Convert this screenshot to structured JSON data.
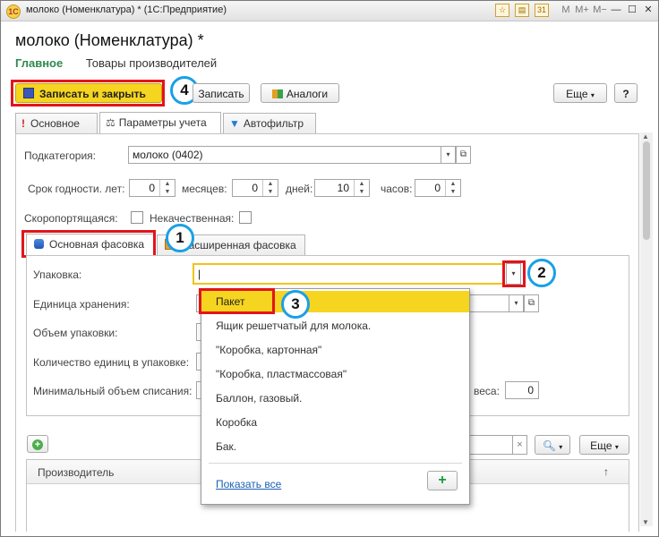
{
  "window": {
    "title": "молоко (Номенклатура) * (1С:Предприятие)",
    "app_icon": "1C",
    "tb_icons": [
      "M",
      "M+",
      "M−",
      "—",
      "☐",
      "✕"
    ]
  },
  "header": {
    "title": "молоко (Номенклатура) *",
    "nav_active": "Главное",
    "nav_other": "Товары производителей"
  },
  "toolbar": {
    "save_close": "Записать и закрыть",
    "save": "Записать",
    "analogs": "Аналоги",
    "more": "Еще",
    "help": "?"
  },
  "tabs": [
    {
      "label": "Основное",
      "icon": "exclamation-icon"
    },
    {
      "label": "Параметры учета",
      "icon": "scales-icon"
    },
    {
      "label": "Автофильтр",
      "icon": "filter-icon"
    }
  ],
  "params": {
    "subcategory_label": "Подкатегория:",
    "subcategory_value": "молоко (0402)",
    "shelf_label": "Срок годности. лет:",
    "years_value": "0",
    "months_label": "месяцев:",
    "months_value": "0",
    "days_label": "дней:",
    "days_value": "10",
    "hours_label": "часов:",
    "hours_value": "0",
    "perishable_label": "Скоропортящаяся:",
    "substandard_label": "Некачественная:"
  },
  "subtabs": [
    {
      "label": "Основная фасовка"
    },
    {
      "label": "Расширенная фасовка"
    }
  ],
  "packaging": {
    "pack_label": "Упаковка:",
    "pack_value": "",
    "storage_unit_label": "Единица хранения:",
    "volume_label": "Объем упаковки:",
    "qty_label": "Количество единиц в упаковке:",
    "min_volume_label": "Минимальный объем списания:",
    "weight_label": "веса:",
    "weight_value": "0"
  },
  "dropdown": {
    "items": [
      "Пакет",
      "Ящик решетчатый для молока.",
      "\"Коробка, картонная\"",
      "\"Коробка, пластмассовая\"",
      "Баллон, газовый.",
      "Коробка",
      "Бак."
    ],
    "selected_index": 0,
    "show_all": "Показать все",
    "add": "+"
  },
  "producers": {
    "more": "Еще",
    "clear": "×",
    "column": "Производитель",
    "sort": "↑"
  },
  "annotations": {
    "n1": "1",
    "n2": "2",
    "n3": "3",
    "n4": "4"
  },
  "colors": {
    "accent": "#2f8a4e",
    "primary_button": "#f5d51f",
    "highlight_box": "#e3141b",
    "badge": "#1aa0e6",
    "link": "#1a5fb4"
  }
}
